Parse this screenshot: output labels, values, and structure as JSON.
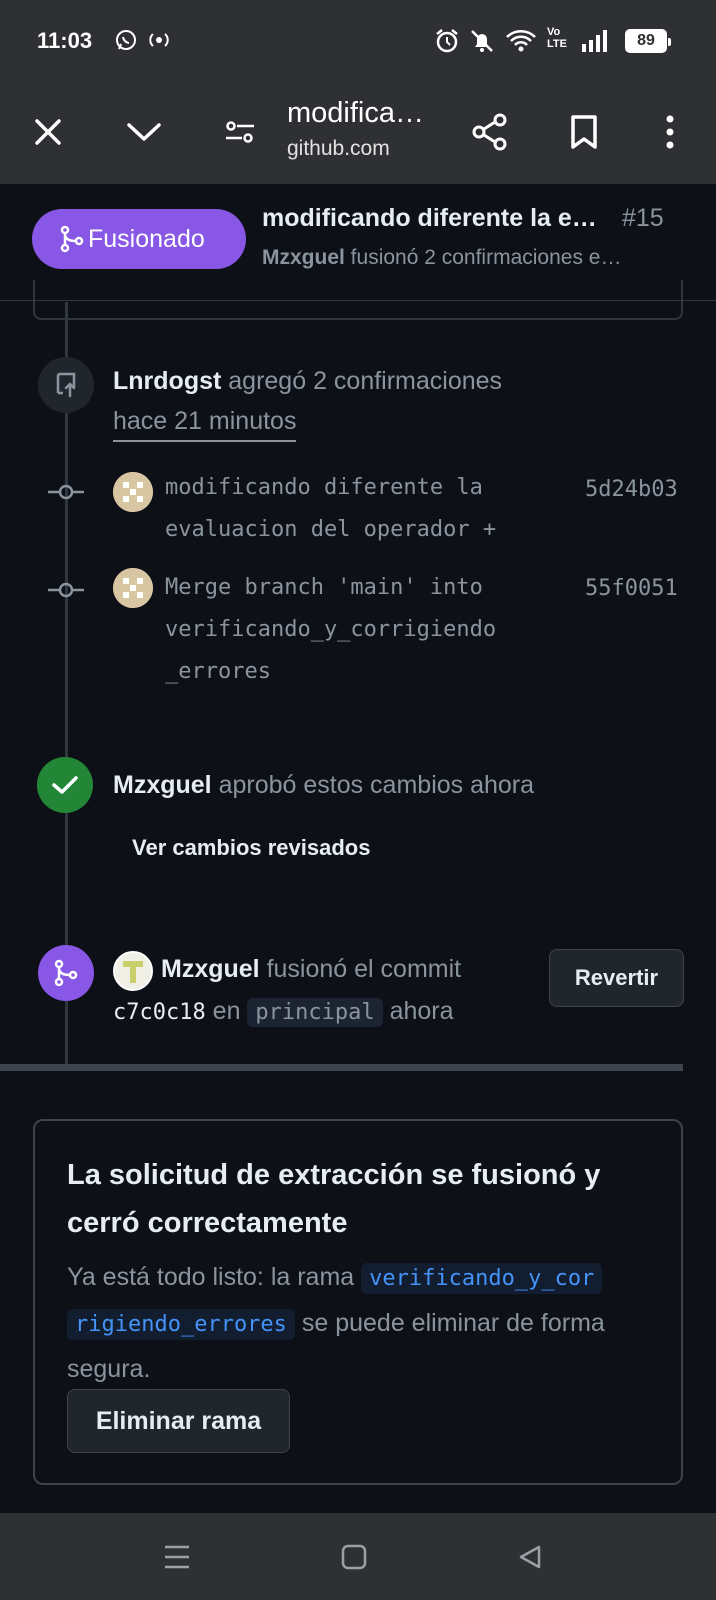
{
  "status_bar": {
    "time": "11:03",
    "battery": "89",
    "icons": [
      "whatsapp-icon",
      "hotspot-icon",
      "alarm-icon",
      "notifications-off-icon",
      "wifi-icon",
      "volte-icon",
      "signal-icon",
      "battery-icon"
    ]
  },
  "toolbar": {
    "title": "modifica…",
    "domain": "github.com"
  },
  "pr_header": {
    "status": "Fusionado",
    "title": "modificando diferente la e…",
    "number": "#15",
    "author": "Mzxguel",
    "subtitle_rest": " fusionó 2 confirmaciones e…"
  },
  "timeline": {
    "commits_event": {
      "user": "Lnrdogst",
      "action": " agregó 2 confirmaciones",
      "time": "hace 21 minutos"
    },
    "commits": [
      {
        "message": "modificando diferente la\nevaluacion del operador +",
        "sha": "5d24b03"
      },
      {
        "message": "Merge branch 'main' into\nverificando_y_corrigiendo\n_errores",
        "sha": "55f0051"
      }
    ],
    "approval": {
      "user": "Mzxguel",
      "action": " aprobó estos cambios ahora",
      "link": "Ver cambios revisados"
    },
    "merge": {
      "user": "Mzxguel",
      "action": " fusionó el commit",
      "commit": "c7c0c18",
      "en": " en ",
      "branch": "principal",
      "time": " ahora",
      "revert_label": "Revertir"
    }
  },
  "merged_card": {
    "title": "La solicitud de extracción se fusionó y cerró correctamente",
    "body_before": "Ya está todo listo: la rama ",
    "branch_line1": "verificando_y_cor",
    "branch_line2": "rigiendo_errores",
    "body_after": " se puede eliminar de forma segura.",
    "delete_button": "Eliminar rama"
  },
  "colors": {
    "merged": "#8957e5",
    "approved": "#238636",
    "link": "#4493f8",
    "background": "#0d1117",
    "chrome": "#2f3033"
  }
}
